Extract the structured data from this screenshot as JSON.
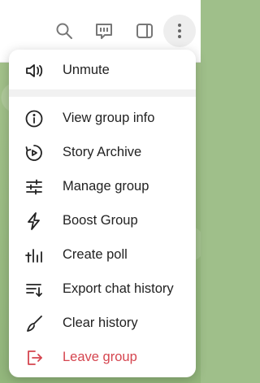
{
  "colors": {
    "danger": "#d5454f",
    "icon": "#222222",
    "menu_bg": "#ffffff"
  },
  "toolbar": {
    "buttons": [
      {
        "name": "search",
        "icon": "search-icon"
      },
      {
        "name": "replies",
        "icon": "replies-icon"
      },
      {
        "name": "sidebar",
        "icon": "sidebar-toggle-icon"
      },
      {
        "name": "more",
        "icon": "more-vertical-icon"
      }
    ]
  },
  "menu": {
    "items": [
      {
        "label": "Unmute",
        "icon": "speaker-icon"
      },
      {
        "label": "View group info",
        "icon": "info-icon"
      },
      {
        "label": "Story Archive",
        "icon": "story-archive-icon"
      },
      {
        "label": "Manage group",
        "icon": "sliders-icon"
      },
      {
        "label": "Boost Group",
        "icon": "boost-icon"
      },
      {
        "label": "Create poll",
        "icon": "poll-icon"
      },
      {
        "label": "Export chat history",
        "icon": "export-icon"
      },
      {
        "label": "Clear history",
        "icon": "broom-icon"
      },
      {
        "label": "Leave group",
        "icon": "leave-icon",
        "danger": true
      }
    ]
  }
}
